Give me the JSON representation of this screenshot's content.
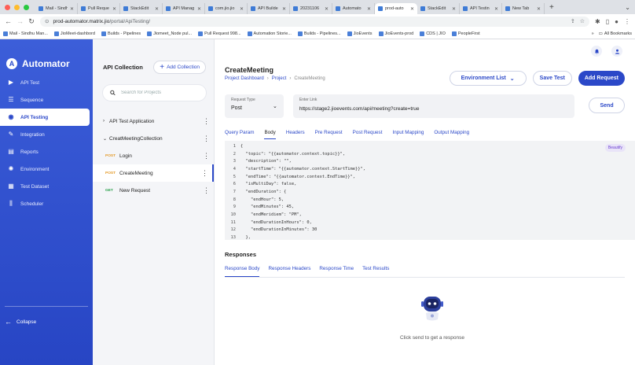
{
  "browser": {
    "tabs": [
      {
        "title": "Mail - Sindh",
        "active": false
      },
      {
        "title": "Pull Reque",
        "active": false
      },
      {
        "title": "StackEdit",
        "active": false
      },
      {
        "title": "API Manag",
        "active": false
      },
      {
        "title": "com.jio.jio",
        "active": false
      },
      {
        "title": "API Builde",
        "active": false
      },
      {
        "title": "20231106",
        "active": false
      },
      {
        "title": "Automato",
        "active": false
      },
      {
        "title": "prod-auto",
        "active": true
      },
      {
        "title": "StackEdit",
        "active": false
      },
      {
        "title": "API Testin",
        "active": false
      },
      {
        "title": "New Tab",
        "active": false
      }
    ],
    "url_host": "prod-automator.matrix.jio",
    "url_path": "/portal/ApiTesting/",
    "bookmarks": [
      "Mail - Sindhu Man...",
      "JioMeet-dashbord",
      "Builds - Pipelines",
      "Jiomeet_Node pul...",
      "Pull Request 998...",
      "Automation Storie...",
      "Builds - Pipelines...",
      "JioEvents",
      "JioEvents-prod",
      "CDS | JIO",
      "PeopleFirst"
    ],
    "all_bookmarks": "All Bookmarks"
  },
  "sidebar": {
    "brand": "Automator",
    "items": [
      {
        "label": "API Test",
        "icon": "video-icon",
        "active": false
      },
      {
        "label": "Sequence",
        "icon": "list-icon",
        "active": false
      },
      {
        "label": "API Testing",
        "icon": "api-icon",
        "active": true
      },
      {
        "label": "Integration",
        "icon": "wrench-icon",
        "active": false
      },
      {
        "label": "Reports",
        "icon": "report-icon",
        "active": false
      },
      {
        "label": "Environment",
        "icon": "gear-icon",
        "active": false
      },
      {
        "label": "Test Dataset",
        "icon": "dataset-icon",
        "active": false
      },
      {
        "label": "Scheduler",
        "icon": "scheduler-icon",
        "active": false
      }
    ],
    "collapse": "Collapse"
  },
  "collection": {
    "title": "API Collection",
    "add_label": "Add Collection",
    "search_placeholder": "Search for Projects",
    "tree": [
      {
        "type": "folder",
        "label": "API Test Application",
        "chev": "›"
      },
      {
        "type": "folder",
        "label": "CreatMeetingCollection",
        "chev": "⌄"
      },
      {
        "type": "request",
        "method": "POST",
        "label": "Login",
        "selected": false
      },
      {
        "type": "request",
        "method": "POST",
        "label": "CreateMeeting",
        "selected": true
      },
      {
        "type": "request",
        "method": "GET",
        "label": "New Request",
        "selected": false
      }
    ]
  },
  "main": {
    "title": "CreateMeeting",
    "breadcrumb": [
      "Project Dashboard",
      "Project",
      "CreateMeeting"
    ],
    "environment_label": "Environment List",
    "save_label": "Save Test",
    "add_request_label": "Add Request",
    "request_type_caption": "Request Type",
    "request_type_value": "Post",
    "link_caption": "Enter Link",
    "link_value": "https://stage2.jioevents.com/api/meeting?create=true",
    "send_label": "Send",
    "request_tabs": [
      "Query Param",
      "Body",
      "Headers",
      "Pre Request",
      "Post Request",
      "Input Mapping",
      "Output Mapping"
    ],
    "active_request_tab": "Body",
    "beautify_label": "Beautify",
    "code_lines": [
      "{",
      "  \"topic\": \"{{automator.context.topic}}\",",
      "  \"description\": \"\",",
      "  \"startTime\": \"{{automator.context.StartTime}}\",",
      "  \"endTime\": \"{{automator.context.EndTime}}\",",
      "  \"isMultiDay\": false,",
      "  \"endDuration\": {",
      "    \"endHour\": 5,",
      "    \"endMinutes\": 45,",
      "    \"endMeridiem\": \"PM\",",
      "    \"endDurationInHours\": 0,",
      "    \"endDurationInMinutes\": 30",
      "  },",
      "  \"participants\": []"
    ],
    "responses_title": "Responses",
    "response_tabs": [
      "Response Body",
      "Response Headers",
      "Response Time",
      "Test Results"
    ],
    "active_response_tab": "Response Body",
    "empty_text": "Click send to get a response"
  },
  "colors": {
    "sidebar_blue": "#2d4bcf",
    "accent": "#2b48c8",
    "post_method": "#e49b2a",
    "get_method": "#2aa14b"
  }
}
